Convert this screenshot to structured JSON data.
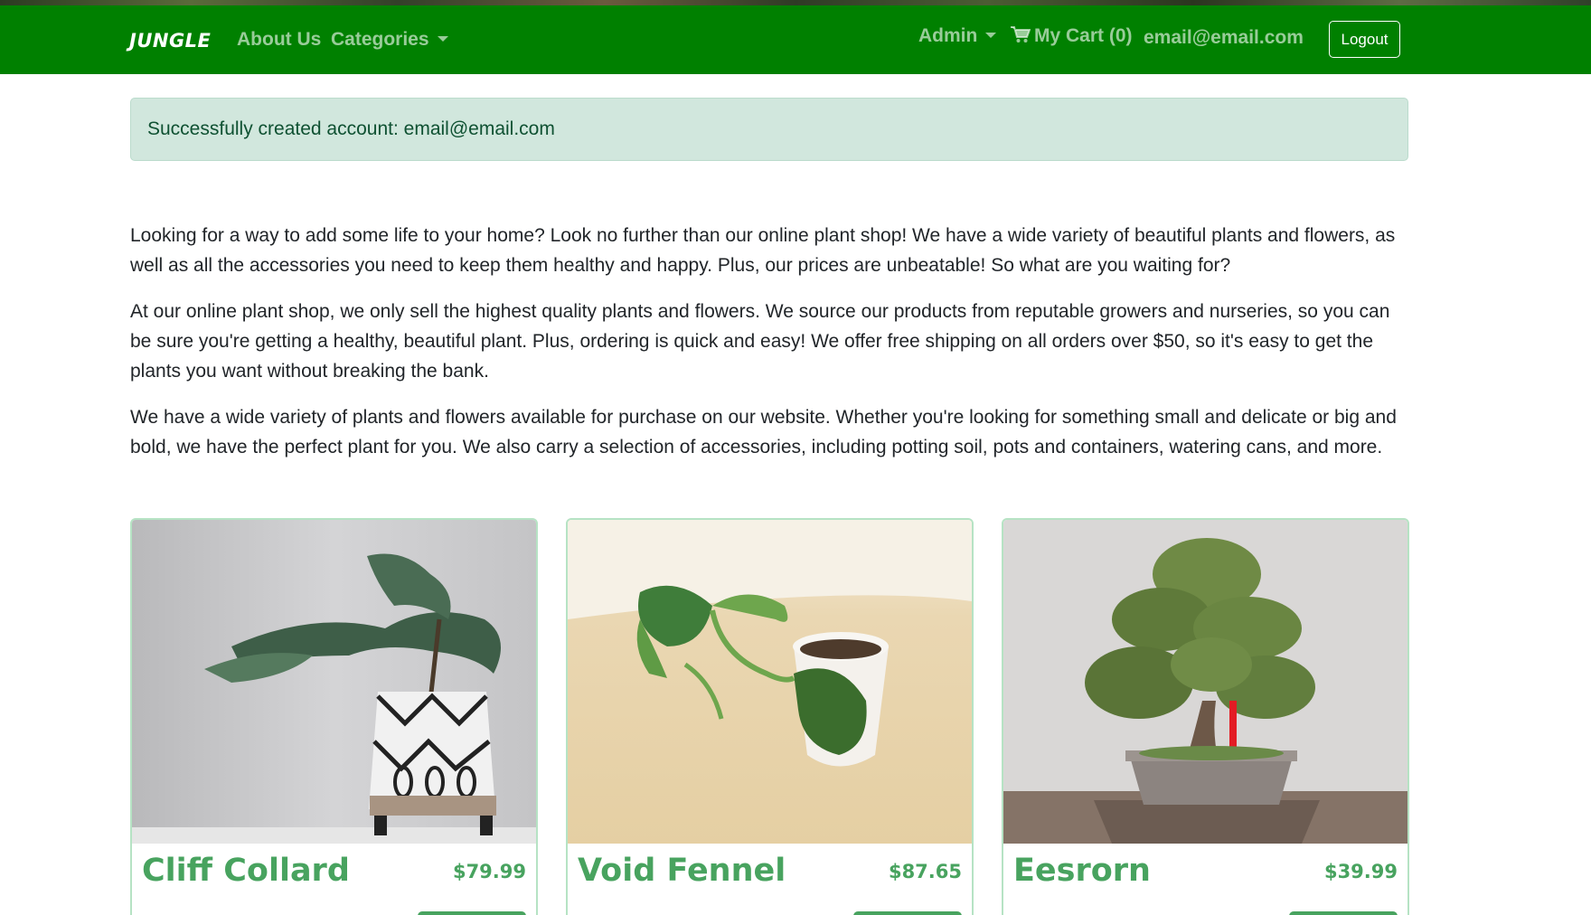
{
  "nav": {
    "brand": "JUNGLE",
    "about": "About Us",
    "categories": "Categories",
    "admin": "Admin",
    "cart": "My Cart (0)",
    "user_email": "email@email.com",
    "logout": "Logout"
  },
  "alert": {
    "message": "Successfully created account: email@email.com"
  },
  "intro": {
    "p1": "Looking for a way to add some life to your home? Look no further than our online plant shop! We have a wide variety of beautiful plants and flowers, as well as all the accessories you need to keep them healthy and happy. Plus, our prices are unbeatable! So what are you waiting for?",
    "p2": "At our online plant shop, we only sell the highest quality plants and flowers. We source our products from reputable growers and nurseries, so you can be sure you're getting a healthy, beautiful plant. Plus, ordering is quick and easy! We offer free shipping on all orders over $50, so it's easy to get the plants you want without breaking the bank.",
    "p3": "We have a wide variety of plants and flowers available for purchase on our website. Whether you're looking for something small and delicate or big and bold, we have the perfect plant for you. We also carry a selection of accessories, including potting soil, pots and containers, watering cans, and more."
  },
  "products": [
    {
      "name": "Cliff Collard",
      "price": "$79.99"
    },
    {
      "name": "Void Fennel",
      "price": "$87.65"
    },
    {
      "name": "Eesrorn",
      "price": "$39.99"
    }
  ],
  "colors": {
    "navbar": "#008000",
    "accent": "#48a35f",
    "alert_bg": "#d1e7dd",
    "alert_text": "#0f5132"
  }
}
